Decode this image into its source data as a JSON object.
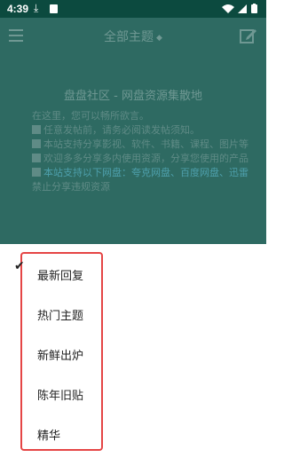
{
  "status_bar": {
    "time": "4:39",
    "download_icon": "download-icon",
    "image_icon": "image-icon",
    "right_icons": "▾◢▮"
  },
  "app_bar": {
    "menu_icon": "hamburger-icon",
    "title": "全部主题",
    "caret": "◆",
    "edit_icon": "edit-icon"
  },
  "notice": {
    "title": "盘盘社区 - 网盘资源集散地",
    "lines": [
      "在这里，您可以畅所欲言。",
      "任意发帖前，请务必阅读发帖须知。",
      "本站支持分享影视、软件、书籍、课程、图片等资源，欢迎大家积极发贴交流。",
      "欢迎多多分享多内使用资源，分享您使用的产品",
      "本站支持以下网盘：夸克网盘、百度网盘、迅雷网盘、阿里网盘、天翼网盘、123网盘",
      "禁止分享违规资源"
    ]
  },
  "dropdown": {
    "selected_index": 0,
    "check_icon": "checkmark-icon",
    "items": [
      "最新回复",
      "热门主题",
      "新鲜出炉",
      "陈年旧贴",
      "精华"
    ]
  },
  "colors": {
    "status_bar": "#0c4a3f",
    "dimmed_bg": "#2e6a62",
    "menu_border": "#e54545"
  }
}
